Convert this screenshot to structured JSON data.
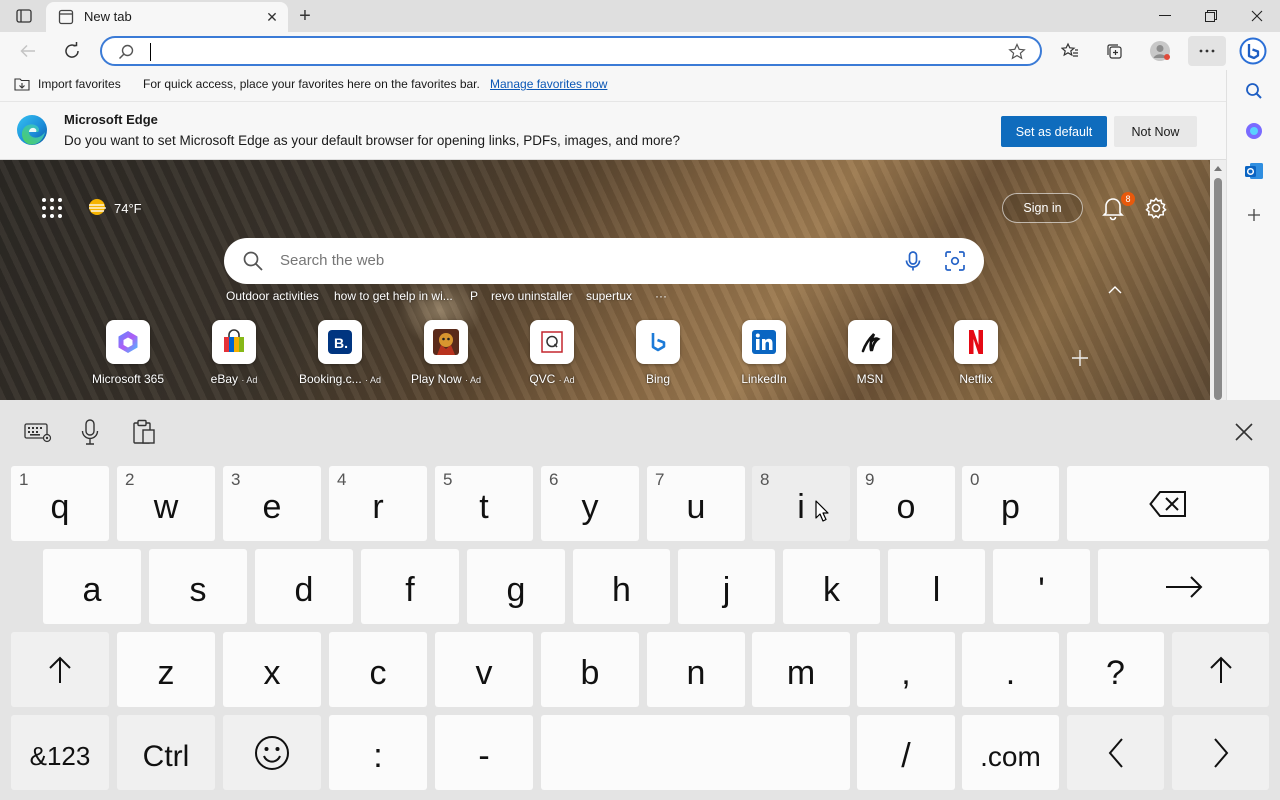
{
  "browser": {
    "tab_title": "New tab",
    "address_value": "",
    "favorites_bar": {
      "import_label": "Import favorites",
      "message": "For quick access, place your favorites here on the favorites bar.",
      "link": "Manage favorites now"
    }
  },
  "banner": {
    "title": "Microsoft Edge",
    "text": "Do you want to set Microsoft Edge as your default browser for opening links, PDFs, images, and more?",
    "primary_label": "Set as default",
    "secondary_label": "Not Now"
  },
  "newtab": {
    "weather": "74°F",
    "sign_in": "Sign in",
    "notification_count": "8",
    "search_placeholder": "Search the web",
    "chips": [
      "Outdoor activities",
      "how to get help in wi...",
      "P",
      "revo uninstaller",
      "supertux",
      "···"
    ],
    "tiles": [
      {
        "label": "Microsoft 365",
        "ad": "",
        "icon": "microsoft365-icon"
      },
      {
        "label": "eBay",
        "ad": "· Ad",
        "icon": "ebay-icon"
      },
      {
        "label": "Booking.c...",
        "ad": "· Ad",
        "icon": "booking-icon"
      },
      {
        "label": "Play Now",
        "ad": "· Ad",
        "icon": "game-icon"
      },
      {
        "label": "QVC",
        "ad": "· Ad",
        "icon": "qvc-icon"
      },
      {
        "label": "Bing",
        "ad": "",
        "icon": "bing-icon"
      },
      {
        "label": "LinkedIn",
        "ad": "",
        "icon": "linkedin-icon"
      },
      {
        "label": "MSN",
        "ad": "",
        "icon": "msn-icon"
      },
      {
        "label": "Netflix",
        "ad": "",
        "icon": "netflix-icon"
      }
    ]
  },
  "keyboard": {
    "row1": [
      {
        "ch": "q",
        "num": "1"
      },
      {
        "ch": "w",
        "num": "2"
      },
      {
        "ch": "e",
        "num": "3"
      },
      {
        "ch": "r",
        "num": "4"
      },
      {
        "ch": "t",
        "num": "5"
      },
      {
        "ch": "y",
        "num": "6"
      },
      {
        "ch": "u",
        "num": "7"
      },
      {
        "ch": "i",
        "num": "8"
      },
      {
        "ch": "o",
        "num": "9"
      },
      {
        "ch": "p",
        "num": "0"
      }
    ],
    "row2": [
      "a",
      "s",
      "d",
      "f",
      "g",
      "h",
      "j",
      "k",
      "l",
      "'"
    ],
    "row3": [
      "z",
      "x",
      "c",
      "v",
      "b",
      "n",
      "m",
      ",",
      ".",
      "?"
    ],
    "row4": {
      "symbols": "&123",
      "ctrl": "Ctrl",
      "colon": ":",
      "dash": "-",
      "slash": "/",
      "dotcom": ".com"
    }
  },
  "colors": {
    "accent": "#0f6cbd",
    "address_border": "#3b7bd6",
    "badge": "#e8590c",
    "netflix": "#e50914",
    "linkedin": "#0a66c2"
  }
}
